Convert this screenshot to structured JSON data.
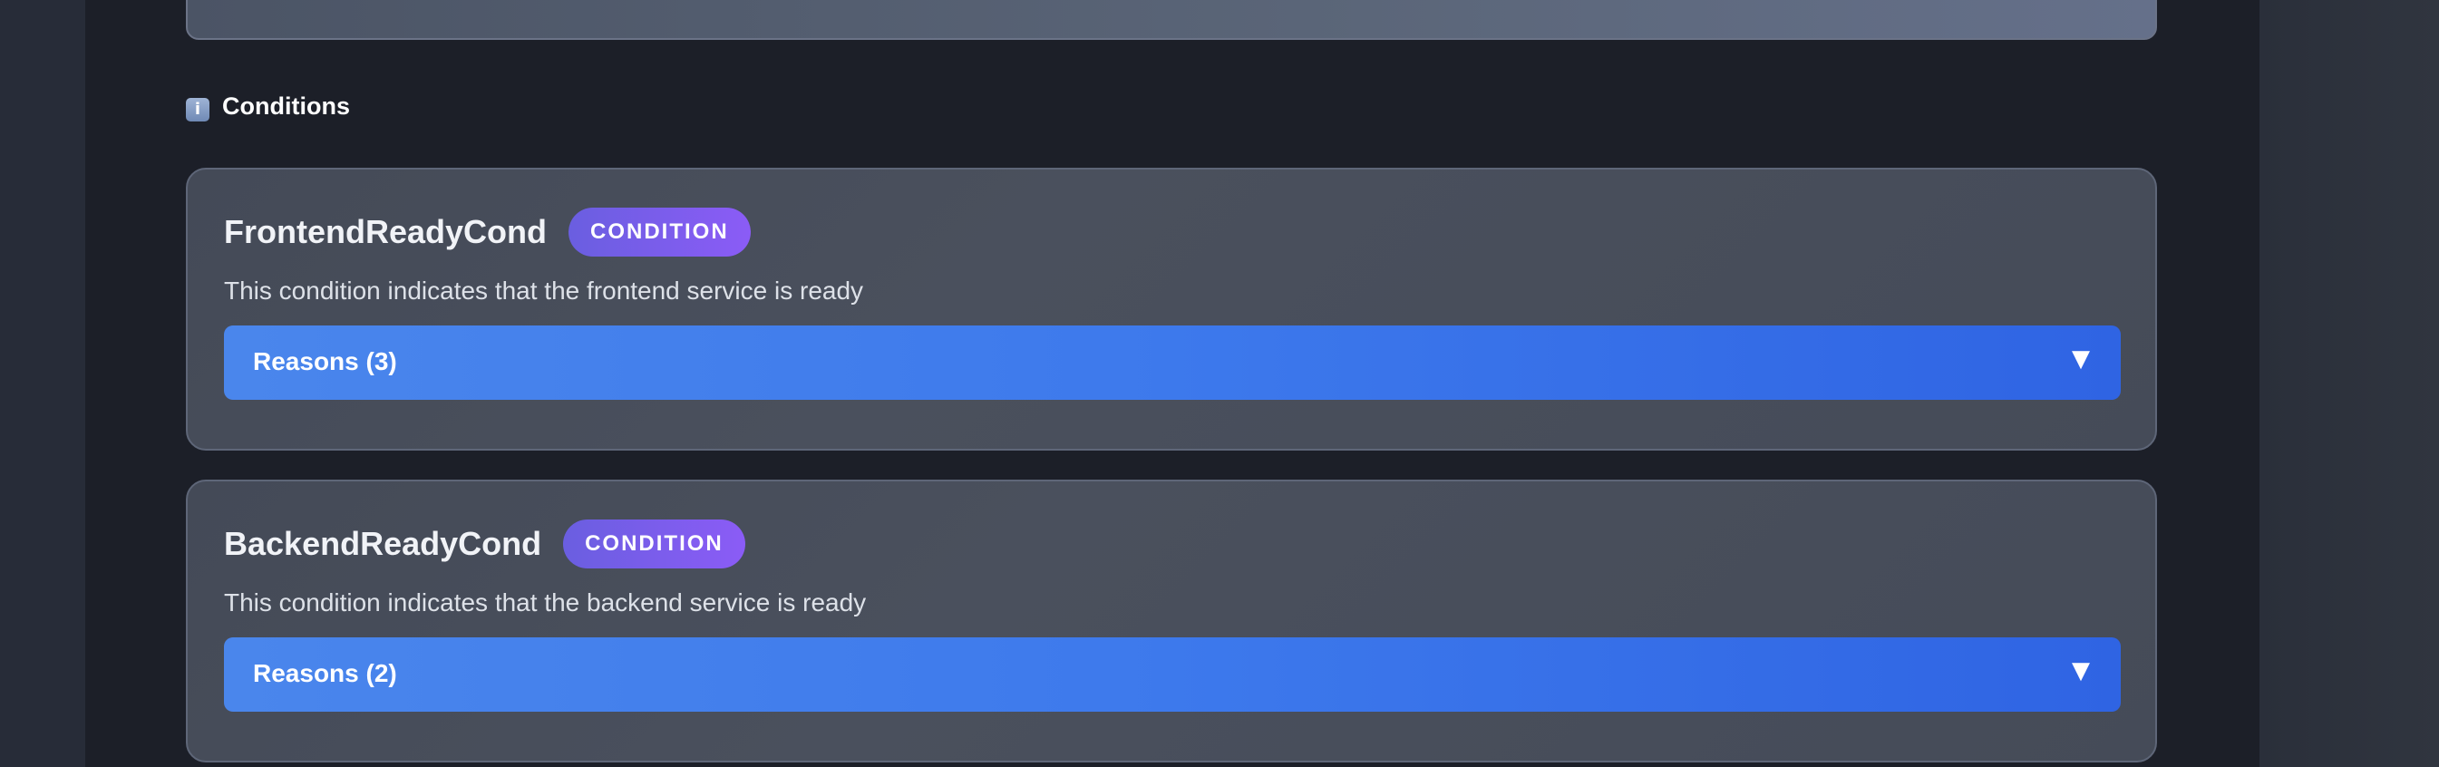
{
  "section": {
    "icon": "info-icon",
    "icon_glyph": "i",
    "title": "Conditions"
  },
  "conditions": [
    {
      "name": "FrontendReadyCond",
      "badge": "CONDITION",
      "description": "This condition indicates that the frontend service is ready",
      "reasons_label": "Reasons (3)",
      "chevron": "▼"
    },
    {
      "name": "BackendReadyCond",
      "badge": "CONDITION",
      "description": "This condition indicates that the backend service is ready",
      "reasons_label": "Reasons (2)",
      "chevron": "▼"
    }
  ],
  "colors": {
    "badge_start": "#6a5ee0",
    "badge_end": "#8b5cf6",
    "reasons_start": "#4a86ec",
    "reasons_end": "#2f64e3",
    "content_bg": "#1c1f28",
    "card_bg": "#484e5b"
  }
}
